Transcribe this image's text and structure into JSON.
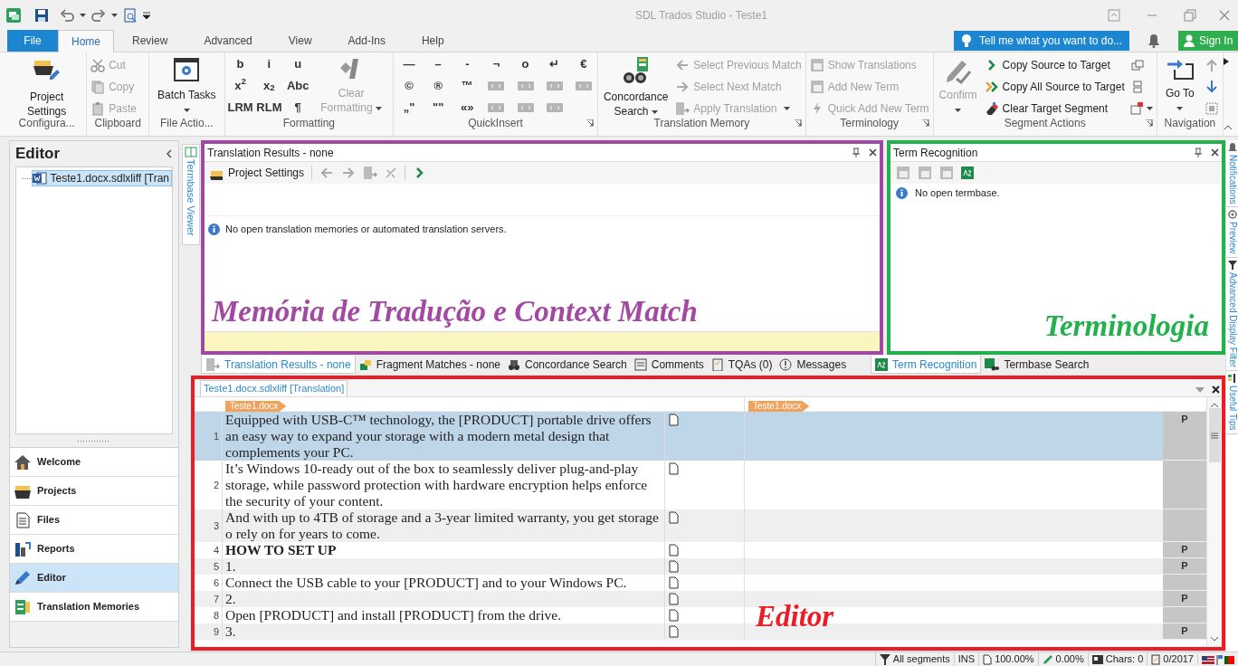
{
  "window": {
    "title": "SDL Trados Studio - Teste1"
  },
  "ribbon_tabs": [
    {
      "label": "File",
      "kind": "file",
      "selected": false
    },
    {
      "label": "Home",
      "kind": "tab",
      "selected": true
    },
    {
      "label": "Review",
      "kind": "tab",
      "selected": false
    },
    {
      "label": "Advanced",
      "kind": "tab",
      "selected": false
    },
    {
      "label": "View",
      "kind": "tab",
      "selected": false
    },
    {
      "label": "Add-Ins",
      "kind": "tab",
      "selected": false
    },
    {
      "label": "Help",
      "kind": "tab",
      "selected": false
    }
  ],
  "tell_me": {
    "placeholder": "Tell me what you want to do..."
  },
  "sign_in": "Sign In",
  "ribbon_groups": [
    {
      "label": "Configura...",
      "items": [
        {
          "kind": "large",
          "label": "Project Settings",
          "disabled": false
        }
      ]
    },
    {
      "label": "Clipboard",
      "items": [
        {
          "kind": "small",
          "label": "Cut",
          "disabled": true
        },
        {
          "kind": "small",
          "label": "Copy",
          "disabled": true
        },
        {
          "kind": "small",
          "label": "Paste",
          "disabled": true
        }
      ]
    },
    {
      "label": "File Actio...",
      "items": [
        {
          "kind": "large",
          "label": "Batch Tasks",
          "dropdown": true,
          "disabled": false
        }
      ]
    },
    {
      "label": "Formatting",
      "items": [
        {
          "kind": "glyph",
          "label": "b"
        },
        {
          "kind": "glyph",
          "label": "i"
        },
        {
          "kind": "glyph",
          "label": "u"
        },
        {
          "kind": "glyph",
          "label": "x$^{2}$"
        },
        {
          "kind": "glyph",
          "label": "x$_{2}$"
        },
        {
          "kind": "glyph",
          "label": "Abc"
        },
        {
          "kind": "glyph",
          "label": "LRM"
        },
        {
          "kind": "glyph",
          "label": "RLM"
        },
        {
          "kind": "glyph",
          "label": "¶"
        },
        {
          "kind": "large",
          "label": "Clear Formatting",
          "dropdown": true,
          "disabled": true
        }
      ]
    },
    {
      "label": "QuickInsert",
      "launcher": true,
      "items": [
        {
          "kind": "glyph",
          "label": "—"
        },
        {
          "kind": "glyph",
          "label": "–"
        },
        {
          "kind": "glyph",
          "label": "-"
        },
        {
          "kind": "glyph",
          "label": "¬"
        },
        {
          "kind": "glyph",
          "label": "o"
        },
        {
          "kind": "glyph",
          "label": "↵"
        },
        {
          "kind": "glyph",
          "label": "€"
        },
        {
          "kind": "glyph",
          "label": "©"
        },
        {
          "kind": "glyph",
          "label": "®"
        },
        {
          "kind": "glyph",
          "label": "™"
        },
        {
          "kind": "tag"
        },
        {
          "kind": "tag"
        },
        {
          "kind": "tag"
        },
        {
          "kind": "tag"
        },
        {
          "kind": "glyph",
          "label": "„\""
        },
        {
          "kind": "glyph",
          "label": "\"\""
        },
        {
          "kind": "glyph",
          "label": "«»"
        },
        {
          "kind": "tag"
        },
        {
          "kind": "tag"
        },
        {
          "kind": "tag"
        }
      ]
    },
    {
      "label": "Translation Memory",
      "launcher": true,
      "items": [
        {
          "kind": "large",
          "label": "Concordance Search",
          "dropdown": true,
          "disabled": false
        },
        {
          "kind": "small",
          "label": "Select Previous Match",
          "disabled": true
        },
        {
          "kind": "small",
          "label": "Select Next Match",
          "disabled": true
        },
        {
          "kind": "small",
          "label": "Apply Translation",
          "dropdown": true,
          "disabled": true
        }
      ]
    },
    {
      "label": "Terminology",
      "launcher": true,
      "items": [
        {
          "kind": "small",
          "label": "Show Translations",
          "disabled": true
        },
        {
          "kind": "small",
          "label": "Add New Term",
          "disabled": true
        },
        {
          "kind": "small",
          "label": "Quick Add New Term",
          "disabled": true
        }
      ]
    },
    {
      "label": "Segment Actions",
      "launcher": true,
      "items": [
        {
          "kind": "large",
          "label": "Confirm",
          "dropdown": true,
          "disabled": true
        },
        {
          "kind": "small",
          "label": "Copy Source to Target",
          "disabled": false
        },
        {
          "kind": "small",
          "label": "Copy All Source to Target",
          "disabled": false
        },
        {
          "kind": "small",
          "label": "Clear Target Segment",
          "disabled": false
        },
        {
          "kind": "icon"
        },
        {
          "kind": "icon"
        },
        {
          "kind": "icon",
          "dropdown": true
        }
      ]
    },
    {
      "label": "Navigation",
      "items": [
        {
          "kind": "large",
          "label": "Go To",
          "dropdown": true,
          "disabled": false
        },
        {
          "kind": "icon"
        },
        {
          "kind": "icon"
        },
        {
          "kind": "icon"
        }
      ]
    }
  ],
  "sidebar": {
    "title": "Editor",
    "tree": [
      {
        "label": "Teste1.docx.sdlxliff [Tran",
        "selected": true
      }
    ],
    "nav": [
      {
        "label": "Welcome",
        "selected": false
      },
      {
        "label": "Projects",
        "selected": false
      },
      {
        "label": "Files",
        "selected": false
      },
      {
        "label": "Reports",
        "selected": false
      },
      {
        "label": "Editor",
        "selected": true
      },
      {
        "label": "Translation Memories",
        "selected": false
      }
    ]
  },
  "left_vertical_tab": "Termbase Viewer",
  "translation_panel": {
    "title": "Translation Results - none",
    "toolbar_button": "Project Settings",
    "message": "No open translation memories or automated translation servers.",
    "annotation": "Memória de Tradução e Context Match"
  },
  "term_panel": {
    "title": "Term Recognition",
    "message": "No open termbase.",
    "annotation": "Terminologia"
  },
  "bottom_tabs_left": [
    {
      "label": "Translation Results - none",
      "selected": true
    },
    {
      "label": "Fragment Matches - none",
      "selected": false
    },
    {
      "label": "Concordance Search",
      "selected": false
    },
    {
      "label": "Comments",
      "selected": false
    },
    {
      "label": "TQAs (0)",
      "selected": false
    },
    {
      "label": "Messages",
      "selected": false
    }
  ],
  "bottom_tabs_right": [
    {
      "label": "Term Recognition",
      "selected": true
    },
    {
      "label": "Termbase Search",
      "selected": false
    }
  ],
  "editor": {
    "document_tab": "Teste1.docx.sdlxliff [Translation]",
    "source_file": "Teste1.docx",
    "target_file": "Teste1.docx",
    "annotation": "Editor",
    "rows": [
      {
        "number": "1",
        "source": "Equipped with USB-C™ technology, the [PRODUCT] portable drive offers an easy way to expand your storage with a modern metal design that complements your PC.",
        "status": "P",
        "selected": true,
        "bold": false
      },
      {
        "number": "2",
        "source": "It’s Windows 10-ready out of the box to seamlessly deliver plug-and-play storage, while password protection with hardware encryption helps enforce the security of your content.",
        "selected": false,
        "bold": false
      },
      {
        "number": "3",
        "source": "And with up to 4TB of storage and a 3-year limited warranty, you get storage o rely on for years to come.",
        "selected": false,
        "bold": false
      },
      {
        "number": "4",
        "source": "HOW TO SET UP",
        "status": "P",
        "selected": false,
        "bold": true
      },
      {
        "number": "5",
        "source": "1.",
        "status": "P",
        "selected": false,
        "bold": false
      },
      {
        "number": "6",
        "source": "Connect the USB cable to your [PRODUCT] and to your Windows PC.",
        "selected": false,
        "bold": false
      },
      {
        "number": "7",
        "source": "2.",
        "status": "P",
        "selected": false,
        "bold": false
      },
      {
        "number": "8",
        "source": "Open [PRODUCT] and install [PRODUCT] from the drive.",
        "selected": false,
        "bold": false
      },
      {
        "number": "9",
        "source": "3.",
        "status": "P",
        "selected": false,
        "bold": false
      }
    ]
  },
  "right_vertical_tabs": [
    "Notifications",
    "Preview",
    "Advanced Display Filter",
    "Useful Tips"
  ],
  "status_bar": [
    "All segments",
    "INS",
    "100.00%",
    "0.00%",
    "Chars: 0",
    "0/2017"
  ]
}
